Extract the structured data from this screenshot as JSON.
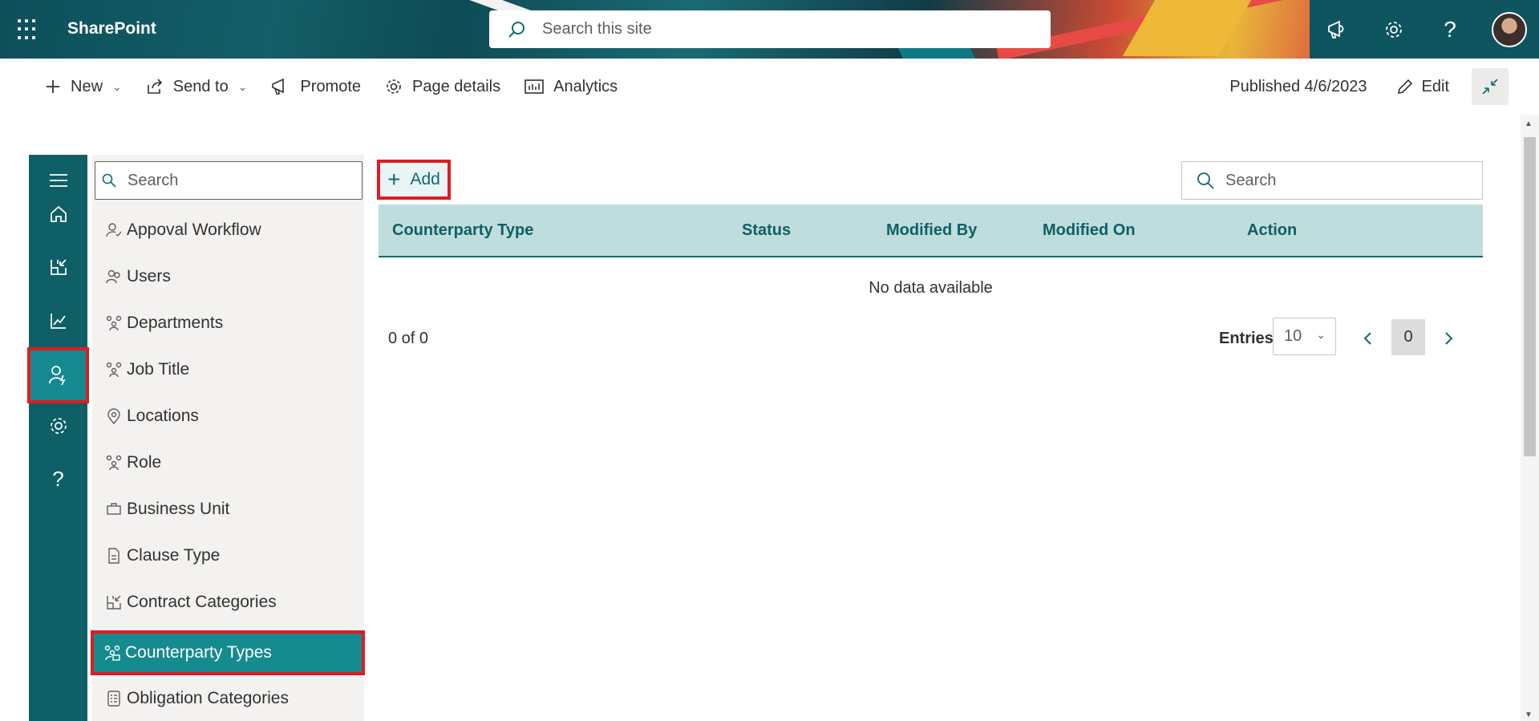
{
  "suite": {
    "brand": "SharePoint",
    "search_placeholder": "Search this site",
    "icons": [
      "megaphone-icon",
      "gear-icon",
      "help-icon"
    ]
  },
  "commandbar": {
    "new_label": "New",
    "send_to_label": "Send to",
    "promote_label": "Promote",
    "page_details_label": "Page details",
    "analytics_label": "Analytics",
    "published": "Published 4/6/2023",
    "edit_label": "Edit"
  },
  "rail": {
    "items": [
      "menu-icon",
      "home-icon",
      "contract-categories-icon",
      "analytics-icon",
      "admin-users-icon",
      "settings-icon",
      "help-icon"
    ],
    "active_index": 4
  },
  "nav": {
    "search_placeholder": "Search",
    "items": [
      {
        "label": "Appoval Workflow",
        "icon": "approval-icon"
      },
      {
        "label": "Users",
        "icon": "users-icon"
      },
      {
        "label": "Departments",
        "icon": "departments-icon"
      },
      {
        "label": "Job Title",
        "icon": "job-title-icon"
      },
      {
        "label": "Locations",
        "icon": "location-icon"
      },
      {
        "label": "Role",
        "icon": "role-icon"
      },
      {
        "label": "Business Unit",
        "icon": "business-unit-icon"
      },
      {
        "label": "Clause Type",
        "icon": "document-icon"
      },
      {
        "label": "Contract Categories",
        "icon": "categories-icon"
      },
      {
        "label": "Counterparty Types",
        "icon": "counterparty-icon"
      },
      {
        "label": "Obligation Categories",
        "icon": "checklist-icon"
      }
    ],
    "active_index": 9
  },
  "main": {
    "add_label": "Add",
    "search_placeholder": "Search",
    "columns": [
      "Counterparty Type",
      "Status",
      "Modified By",
      "Modified On",
      "Action"
    ],
    "empty_text": "No data available",
    "count_text": "0 of 0",
    "entries_label": "Entries",
    "entries_value": "10",
    "current_page": "0"
  },
  "colors": {
    "accent": "#0e5f66",
    "active": "#158a8f",
    "highlight": "#e01b22",
    "table_header": "#bfdddc"
  }
}
